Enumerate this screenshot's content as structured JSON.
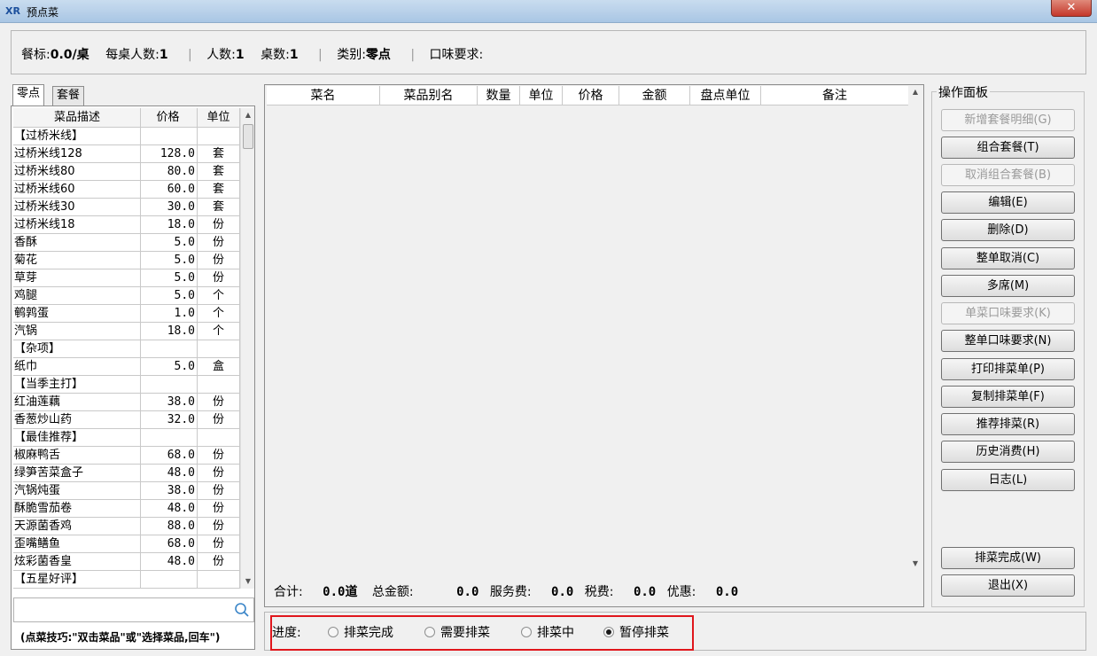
{
  "window": {
    "title": "预点菜",
    "close_label": "✕",
    "icon_label": "XR"
  },
  "info": {
    "table_label": "餐标:",
    "table_value": "0.0/桌",
    "per_table_label": "每桌人数:",
    "per_table_value": "1",
    "people_label": "人数:",
    "people_value": "1",
    "tables_label": "桌数:",
    "tables_value": "1",
    "category_label": "类别:",
    "category_value": "零点",
    "taste_label": "口味要求:"
  },
  "tabs": {
    "a_la_carte": "零点",
    "set_meal": "套餐"
  },
  "menu": {
    "headers": [
      "菜品描述",
      "价格",
      "单位"
    ],
    "rows": [
      [
        "【过桥米线】",
        "",
        ""
      ],
      [
        "过桥米线128",
        "128.0",
        "套"
      ],
      [
        "过桥米线80",
        "80.0",
        "套"
      ],
      [
        "过桥米线60",
        "60.0",
        "套"
      ],
      [
        "过桥米线30",
        "30.0",
        "套"
      ],
      [
        "过桥米线18",
        "18.0",
        "份"
      ],
      [
        "香酥",
        "5.0",
        "份"
      ],
      [
        "菊花",
        "5.0",
        "份"
      ],
      [
        "草芽",
        "5.0",
        "份"
      ],
      [
        "鸡腿",
        "5.0",
        "个"
      ],
      [
        "鹌鹑蛋",
        "1.0",
        "个"
      ],
      [
        "汽锅",
        "18.0",
        "个"
      ],
      [
        "【杂项】",
        "",
        ""
      ],
      [
        "纸巾",
        "5.0",
        "盒"
      ],
      [
        "【当季主打】",
        "",
        ""
      ],
      [
        "红油莲藕",
        "38.0",
        "份"
      ],
      [
        "香葱炒山药",
        "32.0",
        "份"
      ],
      [
        "【最佳推荐】",
        "",
        ""
      ],
      [
        "椒麻鸭舌",
        "68.0",
        "份"
      ],
      [
        "绿笋苦菜盒子",
        "48.0",
        "份"
      ],
      [
        "汽锅炖蛋",
        "38.0",
        "份"
      ],
      [
        "酥脆雪茄卷",
        "48.0",
        "份"
      ],
      [
        "天源菌香鸡",
        "88.0",
        "份"
      ],
      [
        "歪嘴鳝鱼",
        "68.0",
        "份"
      ],
      [
        "炫彩菌香皇",
        "48.0",
        "份"
      ],
      [
        "【五星好评】",
        "",
        ""
      ]
    ]
  },
  "search": {
    "value": "",
    "placeholder": ""
  },
  "tip": "(点菜技巧:\"双击菜品\"或\"选择菜品,回车\")",
  "order": {
    "headers": [
      "菜名",
      "菜品别名",
      "数量",
      "单位",
      "价格",
      "金额",
      "盘点单位",
      "备注"
    ],
    "rows": []
  },
  "totals": {
    "sum_label": "合计:",
    "sum_value": "0.0道",
    "amount_label": "总金额:",
    "amount_value": "0.0",
    "service_label": "服务费:",
    "service_value": "0.0",
    "tax_label": "税费:",
    "tax_value": "0.0",
    "discount_label": "优惠:",
    "discount_value": "0.0"
  },
  "ops": {
    "title": "操作面板",
    "buttons": [
      {
        "label": "新增套餐明细(G)",
        "enabled": false
      },
      {
        "label": "组合套餐(T)",
        "enabled": true
      },
      {
        "label": "取消组合套餐(B)",
        "enabled": false
      },
      {
        "label": "编辑(E)",
        "enabled": true
      },
      {
        "label": "删除(D)",
        "enabled": true
      },
      {
        "label": "整单取消(C)",
        "enabled": true
      },
      {
        "label": "多席(M)",
        "enabled": true
      },
      {
        "label": "单菜口味要求(K)",
        "enabled": false
      },
      {
        "label": "整单口味要求(N)",
        "enabled": true
      },
      {
        "label": "打印排菜单(P)",
        "enabled": true
      },
      {
        "label": "复制排菜单(F)",
        "enabled": true
      },
      {
        "label": "推荐排菜(R)",
        "enabled": true
      },
      {
        "label": "历史消费(H)",
        "enabled": true
      },
      {
        "label": "日志(L)",
        "enabled": true
      }
    ],
    "finish": "排菜完成(W)",
    "exit": "退出(X)"
  },
  "progress": {
    "label": "进度:",
    "options": [
      "排菜完成",
      "需要排菜",
      "排菜中",
      "暂停排菜"
    ],
    "selected": "暂停排菜"
  },
  "colors": {
    "highlight": "#e0161c",
    "title_bar": "#a9c6e4"
  }
}
